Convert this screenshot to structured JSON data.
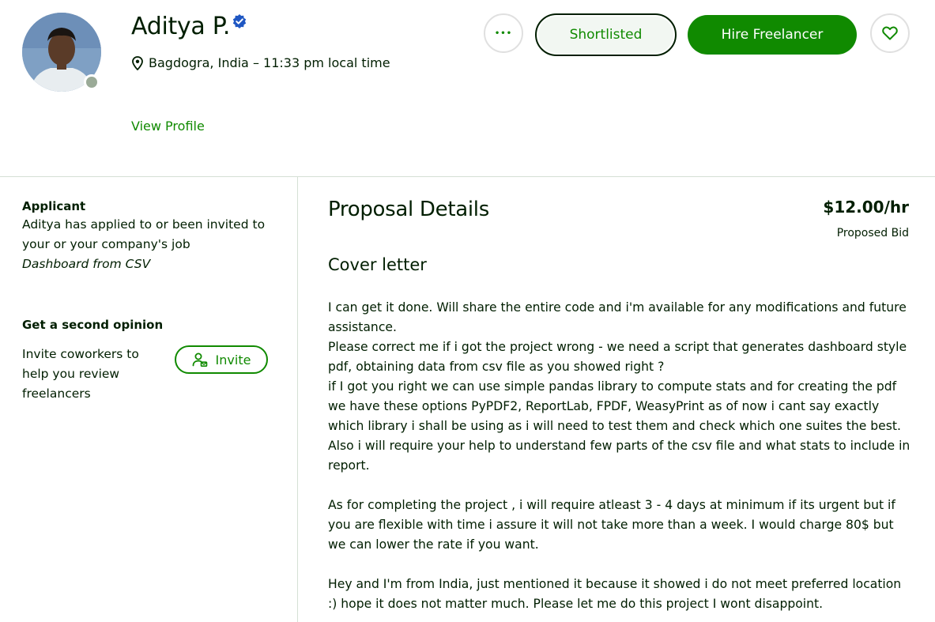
{
  "profile": {
    "name": "Aditya P.",
    "location": "Bagdogra, India – 11:33 pm local time",
    "view_profile": "View Profile"
  },
  "actions": {
    "more": "•••",
    "shortlisted": "Shortlisted",
    "hire": "Hire Freelancer"
  },
  "sidebar": {
    "applicant_heading": "Applicant",
    "applicant_text": "Aditya has applied to or been invited to your or your company's job",
    "job_title": "Dashboard from CSV",
    "second_opinion_heading": "Get a second opinion",
    "invite_text": "Invite coworkers to help you review freelancers",
    "invite_button": "Invite"
  },
  "proposal": {
    "title": "Proposal Details",
    "bid": "$12.00/hr",
    "bid_label": "Proposed Bid",
    "cover_title": "Cover letter",
    "paragraphs": [
      "I can get it done. Will share the entire code and i'm available for any modifications and future assistance.",
      "Please correct me if i got the project wrong - we need a script that generates dashboard style pdf, obtaining data from csv file as you showed right ?",
      "if I got you right we can use simple pandas library to compute stats and for creating the pdf we have these options PyPDF2, ReportLab, FPDF, WeasyPrint as of now i cant say exactly which library i shall be using as i will need to test them and check which one suites the best. Also i will require your help to understand few parts of the csv file and what stats to include in report.",
      "As for completing the project , i will require atleast 3 - 4 days at minimum if its urgent but if you are flexible with time i assure it will not take more than a week. I would charge 80$ but we can lower the rate if you want.",
      "Hey and I'm from India, just mentioned it because it showed i do not meet preferred location :) hope it does not matter much. Please let me do this project I wont disappoint."
    ]
  },
  "colors": {
    "brand_green": "#108a00",
    "text": "#001e00",
    "verified_blue": "#1f57c3",
    "status_offline": "#9aaa97"
  },
  "icons": [
    "verified-badge-icon",
    "location-pin-icon",
    "more-icon",
    "heart-icon",
    "invite-person-icon"
  ]
}
